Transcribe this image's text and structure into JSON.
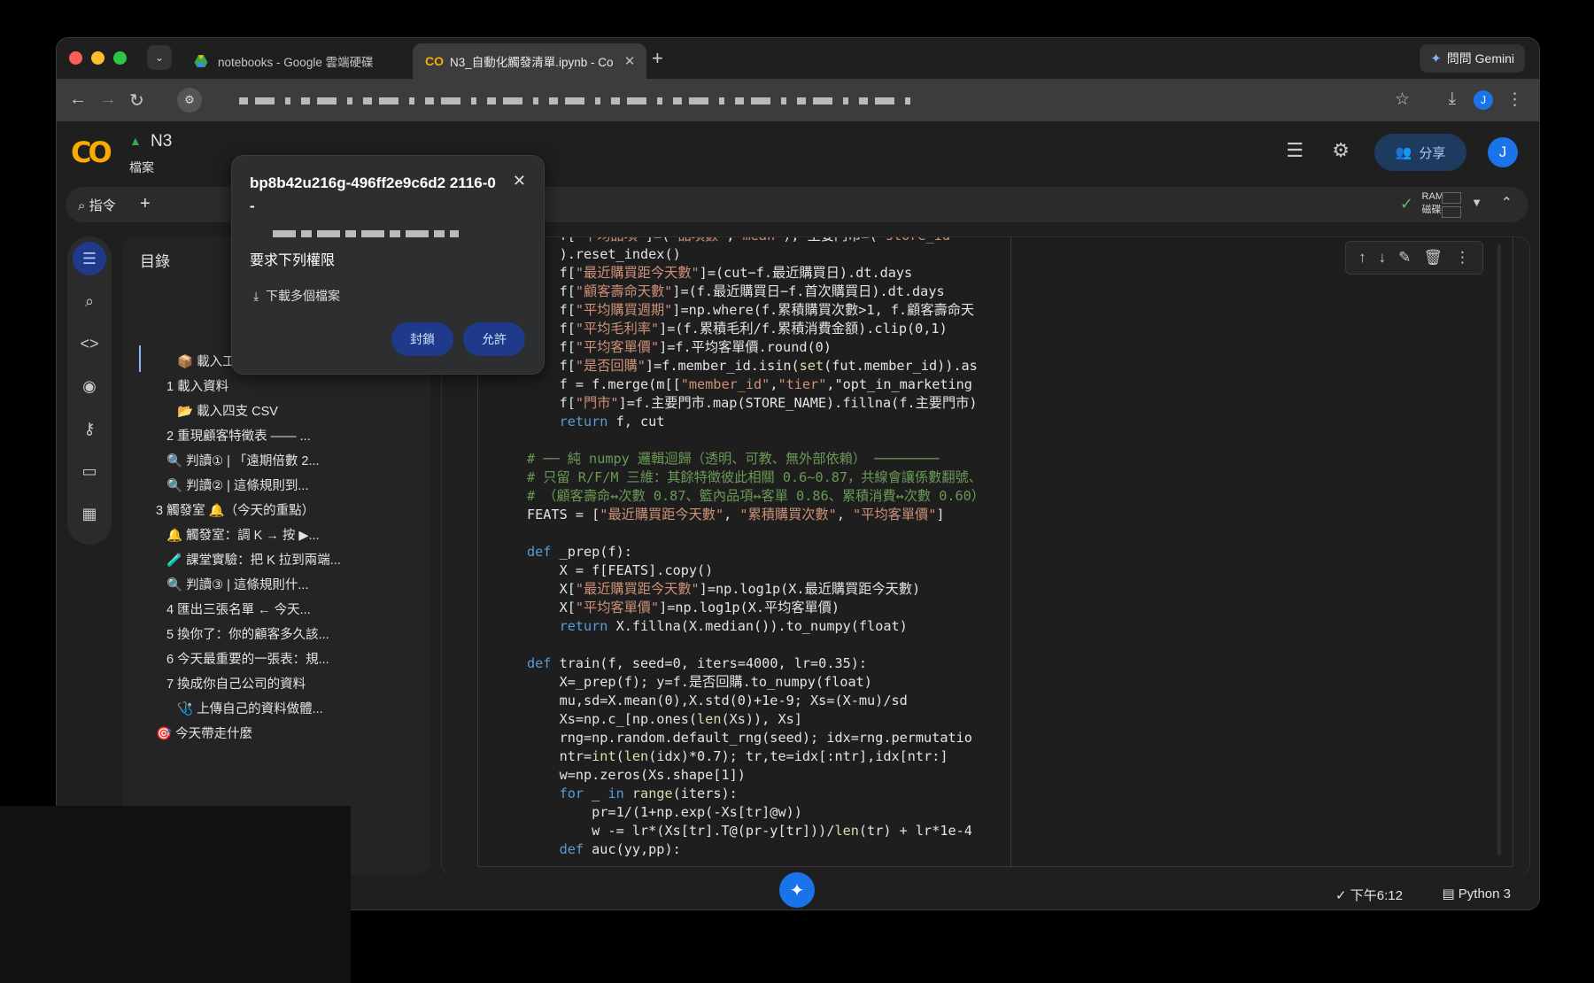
{
  "browser": {
    "tabs": [
      {
        "title": "notebooks - Google 雲端硬碟",
        "active": false
      },
      {
        "title": "N3_自動化觸發清單.ipynb - Co",
        "active": true
      }
    ],
    "gemini_button": "問問 Gemini",
    "profile_initial": "J"
  },
  "colab": {
    "notebook_title_short": "N3",
    "menu_file": "檔案",
    "share_label": "分享",
    "avatar_initial": "J",
    "command_label": "指令",
    "resources": {
      "ram": "RAM",
      "disk": "磁碟"
    }
  },
  "popup": {
    "host": "bp8b42u216g-496ff2e9c6d2 2116-0-",
    "request": "要求下列權限",
    "permission": "下載多個檔案",
    "block": "封鎖",
    "allow": "允許"
  },
  "toc": {
    "title": "目錄",
    "items": [
      "📦 載入工具箱",
      "1 載入資料",
      "📂 載入四支 CSV",
      "2 重現顧客特徵表 —— ...",
      "🔍 判讀① | 「遠期倍數 2...",
      "🔍 判讀② | 這條規則到...",
      "3 觸發室 🔔（今天的重點）",
      "🔔 觸發室：調 K → 按 ▶...",
      "🧪 課堂實驗：把 K 拉到兩端...",
      "🔍 判讀③ | 這條規則什...",
      "4 匯出三張名單 ← 今天...",
      "5 換你了：你的顧客多久該...",
      "6 今天最重要的一張表：規...",
      "7 換成你自己公司的資料",
      "🩺 上傳自己的資料做體...",
      "🎯 今天帶走什麼"
    ]
  },
  "code_lines": [
    "    f[\"平均品項\"]=(\"品項數\",\"mean\"), 主要門市=(\"store_id\"",
    "    ).reset_index()",
    "    f[\"最近購買距今天數\"]=(cut−f.最近購買日).dt.days",
    "    f[\"顧客壽命天數\"]=(f.最近購買日−f.首次購買日).dt.days",
    "    f[\"平均購買週期\"]=np.where(f.累積購買次數>1, f.顧客壽命天",
    "    f[\"平均毛利率\"]=(f.累積毛利/f.累積消費金額).clip(0,1)",
    "    f[\"平均客單價\"]=f.平均客單價.round(0)",
    "    f[\"是否回購\"]=f.member_id.isin(set(fut.member_id)).as",
    "    f = f.merge(m[[\"member_id\",\"tier\",\"opt_in_marketing",
    "    f[\"門市\"]=f.主要門市.map(STORE_NAME).fillna(f.主要門市)",
    "    return f, cut",
    "",
    "# ── 純 numpy 邏輯迴歸（透明、可教、無外部依賴） ────────",
    "# 只留 R/F/M 三維：其餘特徵彼此相關 0.6~0.87，共線會讓係數翻號、",
    "# （顧客壽命↔次數 0.87、籃內品項↔客單 0.86、累積消費↔次數 0.60）",
    "FEATS = [\"最近購買距今天數\", \"累積購買次數\", \"平均客單價\"]",
    "",
    "def _prep(f):",
    "    X = f[FEATS].copy()",
    "    X[\"最近購買距今天數\"]=np.log1p(X.最近購買距今天數)",
    "    X[\"平均客單價\"]=np.log1p(X.平均客單價)",
    "    return X.fillna(X.median()).to_numpy(float)",
    "",
    "def train(f, seed=0, iters=4000, lr=0.35):",
    "    X=_prep(f); y=f.是否回購.to_numpy(float)",
    "    mu,sd=X.mean(0),X.std(0)+1e-9; Xs=(X-mu)/sd",
    "    Xs=np.c_[np.ones(len(Xs)), Xs]",
    "    rng=np.random.default_rng(seed); idx=rng.permutatio",
    "    ntr=int(len(idx)*0.7); tr,te=idx[:ntr],idx[ntr:]",
    "    w=np.zeros(Xs.shape[1])",
    "    for _ in range(iters):",
    "        pr=1/(1+np.exp(-Xs[tr]@w))",
    "        w -= lr*(Xs[tr].T@(pr-y[tr]))/len(tr) + lr*1e-4",
    "    def auc(yy,pp):"
  ],
  "status": {
    "time": "下午6:12",
    "runtime": "Python 3"
  },
  "colors": {
    "accent": "#1a73e8",
    "logo": "#f9ab00",
    "bg": "#1f1f1f"
  }
}
